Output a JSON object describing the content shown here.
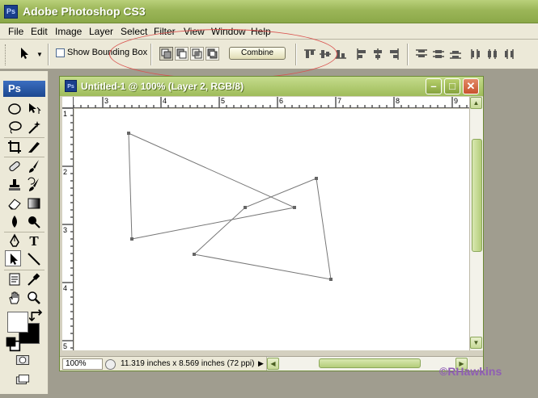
{
  "app": {
    "title": "Adobe Photoshop CS3",
    "logo": "Ps"
  },
  "menu": [
    "File",
    "Edit",
    "Image",
    "Layer",
    "Select",
    "Filter",
    "View",
    "Window",
    "Help"
  ],
  "options": {
    "show_bounding_box": "Show Bounding Box",
    "combine": "Combine"
  },
  "toolbox": {
    "badge": "Ps",
    "tools": [
      "marquee-ellipse-icon",
      "move-icon",
      "lasso-icon",
      "magic-wand-icon",
      "crop-icon",
      "slice-icon",
      "healing-brush-icon",
      "brush-icon",
      "clone-stamp-icon",
      "history-brush-icon",
      "eraser-icon",
      "gradient-icon",
      "blur-icon",
      "dodge-icon",
      "pen-icon",
      "type-icon",
      "path-selection-icon",
      "line-icon",
      "notes-icon",
      "eyedropper-icon",
      "hand-icon",
      "zoom-icon"
    ],
    "type_glyph": "T"
  },
  "document": {
    "title": "Untitled-1 @ 100% (Layer 2, RGB/8)",
    "ruler_h": [
      "3",
      "4",
      "5",
      "6",
      "7",
      "8",
      "9"
    ],
    "ruler_v": [
      "1",
      "2",
      "3",
      "4",
      "5"
    ],
    "zoom": "100%",
    "info": "11.319 inches x 8.569 inches (72 ppi)"
  },
  "watermark": "©RHawkins"
}
